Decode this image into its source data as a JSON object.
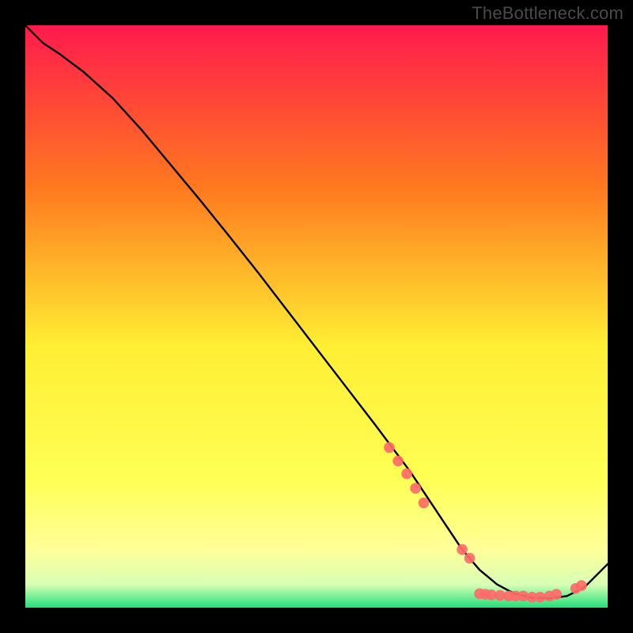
{
  "watermark": "TheBottleneck.com",
  "chart_data": {
    "type": "line",
    "title": "",
    "xlabel": "",
    "ylabel": "",
    "xlim": [
      0,
      100
    ],
    "ylim": [
      0,
      100
    ],
    "background_gradient": {
      "top": "#ff1a4d",
      "upper_mid": "#ff9a1f",
      "mid": "#ffee33",
      "lower_mid": "#ffff99",
      "bottom": "#22e07a"
    },
    "series": [
      {
        "name": "curve",
        "color": "#000000",
        "x": [
          0,
          3,
          6,
          10,
          15,
          20,
          25,
          30,
          35,
          40,
          45,
          50,
          55,
          60,
          63,
          66,
          69,
          72,
          75,
          78,
          81,
          84,
          87,
          90,
          93,
          96,
          100
        ],
        "y": [
          100,
          97,
          95,
          92,
          87.5,
          82,
          76,
          70,
          63.8,
          57.5,
          51,
          44.5,
          38,
          31.5,
          27.5,
          23.5,
          19,
          14.5,
          10,
          6.5,
          4,
          2.4,
          1.7,
          1.6,
          2.0,
          3.5,
          7.5
        ]
      }
    ],
    "markers": {
      "name": "dots",
      "color": "#ff6a6a",
      "points": [
        {
          "x": 62.5,
          "y": 27.5
        },
        {
          "x": 64.0,
          "y": 25.2
        },
        {
          "x": 65.5,
          "y": 23.0
        },
        {
          "x": 67.0,
          "y": 20.5
        },
        {
          "x": 68.4,
          "y": 18.0
        },
        {
          "x": 75.0,
          "y": 10.0
        },
        {
          "x": 76.3,
          "y": 8.5
        },
        {
          "x": 78.0,
          "y": 2.4
        },
        {
          "x": 79.0,
          "y": 2.3
        },
        {
          "x": 80.0,
          "y": 2.2
        },
        {
          "x": 81.5,
          "y": 2.1
        },
        {
          "x": 83.0,
          "y": 2.0
        },
        {
          "x": 84.2,
          "y": 2.0
        },
        {
          "x": 85.5,
          "y": 2.0
        },
        {
          "x": 87.0,
          "y": 1.8
        },
        {
          "x": 88.4,
          "y": 1.8
        },
        {
          "x": 90.0,
          "y": 2.0
        },
        {
          "x": 91.2,
          "y": 2.3
        },
        {
          "x": 94.5,
          "y": 3.3
        },
        {
          "x": 95.5,
          "y": 3.8
        }
      ]
    }
  }
}
